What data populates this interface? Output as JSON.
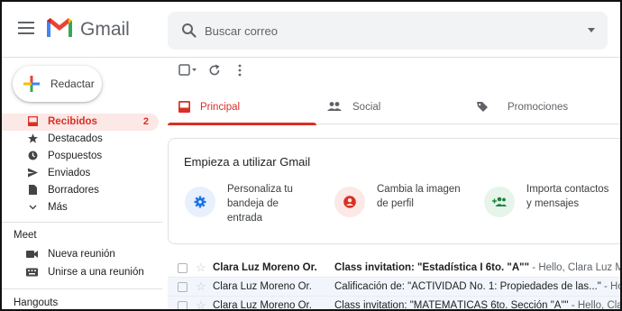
{
  "app": {
    "name": "Gmail"
  },
  "search": {
    "placeholder": "Buscar correo"
  },
  "compose": {
    "label": "Redactar"
  },
  "sidebar": {
    "items": [
      {
        "label": "Recibidos",
        "count": "2",
        "icon": "inbox-icon",
        "active": true
      },
      {
        "label": "Destacados",
        "icon": "star-icon"
      },
      {
        "label": "Pospuestos",
        "icon": "clock-icon"
      },
      {
        "label": "Enviados",
        "icon": "send-icon"
      },
      {
        "label": "Borradores",
        "icon": "draft-icon"
      },
      {
        "label": "Más",
        "icon": "chevron-down-icon"
      }
    ],
    "meet": {
      "title": "Meet",
      "items": [
        {
          "label": "Nueva reunión",
          "icon": "video-icon"
        },
        {
          "label": "Unirse a una reunión",
          "icon": "keyboard-icon"
        }
      ]
    },
    "hangouts": {
      "title": "Hangouts"
    }
  },
  "tabs": [
    {
      "label": "Principal",
      "icon": "inbox-icon",
      "active": true
    },
    {
      "label": "Social",
      "icon": "people-icon"
    },
    {
      "label": "Promociones",
      "icon": "tag-icon"
    }
  ],
  "promo": {
    "title": "Empieza a utilizar Gmail",
    "cards": [
      {
        "text": "Personaliza tu\nbandeja de\nentrada",
        "icon": "gear-icon"
      },
      {
        "text": "Cambia la imagen\nde perfil",
        "icon": "account-icon"
      },
      {
        "text": "Importa contactos\ny mensajes",
        "icon": "add-people-icon"
      }
    ]
  },
  "emails": [
    {
      "sender": "Clara Luz Moreno Or.",
      "subject": "Class invitation: \"Estadística I 6to. \"A\"\"",
      "snippet": " - Hello, Clara Luz Moreno Orellana",
      "unread": true
    },
    {
      "sender": "Clara Luz Moreno Or.",
      "subject": "Calificación de: \"ACTIVIDAD No. 1: Propiedades de las...\"",
      "snippet": " - Hola, Alejandro:",
      "unread": false
    },
    {
      "sender": "Clara Luz Moreno Or.",
      "subject": "Class invitation: \"MATEMÁTICAS 6to. Sección \"A\"\"",
      "snippet": " - Hello, Clara Luz Moreno",
      "unread": false
    }
  ],
  "colors": {
    "accent": "#d93025",
    "blue": "#1a73e8",
    "green": "#188038"
  }
}
